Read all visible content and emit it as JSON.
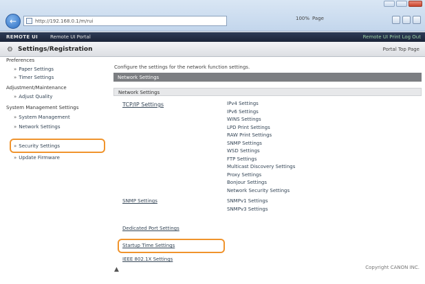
{
  "browser": {
    "address": "http://192.168.0.1/m/rui",
    "zoom": "100%",
    "page_ctrl_label": "Page"
  },
  "header": {
    "logo": "REMOTE UI",
    "device": "Remote UI Portal",
    "right_links": "Remote UI   Print   Log Out"
  },
  "titlebar": {
    "title": "Settings/Registration",
    "top_link": "Portal Top Page"
  },
  "sidebar": {
    "groups": [
      {
        "label": "Preferences",
        "items": [
          "Paper Settings",
          "Timer Settings"
        ]
      },
      {
        "label": "Adjustment/Maintenance",
        "items": [
          "Adjust Quality"
        ]
      },
      {
        "label": "System Management Settings",
        "items": [
          "System Management",
          "Network Settings",
          "Security Settings"
        ]
      }
    ],
    "extra_item": "Update Firmware"
  },
  "main": {
    "intro": "Configure the settings for the network function settings.",
    "section_title": "Network Settings",
    "subsection_title": "Network Settings",
    "tcpip_label": "TCP/IP Settings",
    "tcpip_links": [
      "IPv4 Settings",
      "IPv6 Settings",
      "WINS Settings",
      "LPD Print Settings",
      "RAW Print Settings",
      "SNMP Settings",
      "WSD Settings",
      "FTP Settings",
      "Multicast Discovery Settings",
      "Proxy Settings",
      "Bonjour Settings",
      "Network Security Settings"
    ],
    "snmp_label": "SNMP Settings",
    "snmp_links": [
      "SNMPv1 Settings",
      "SNMPv3 Settings"
    ],
    "dedicated_port": "Dedicated Port Settings",
    "highlighted_link": "Startup Time Settings",
    "ieee_link": "IEEE 802.1X Settings",
    "page_top": "▲",
    "footer": "Copyright CANON INC."
  },
  "colors": {
    "header_bg": "#1b2438",
    "section_bar": "#7c7e82",
    "highlight": "#f0932b"
  }
}
